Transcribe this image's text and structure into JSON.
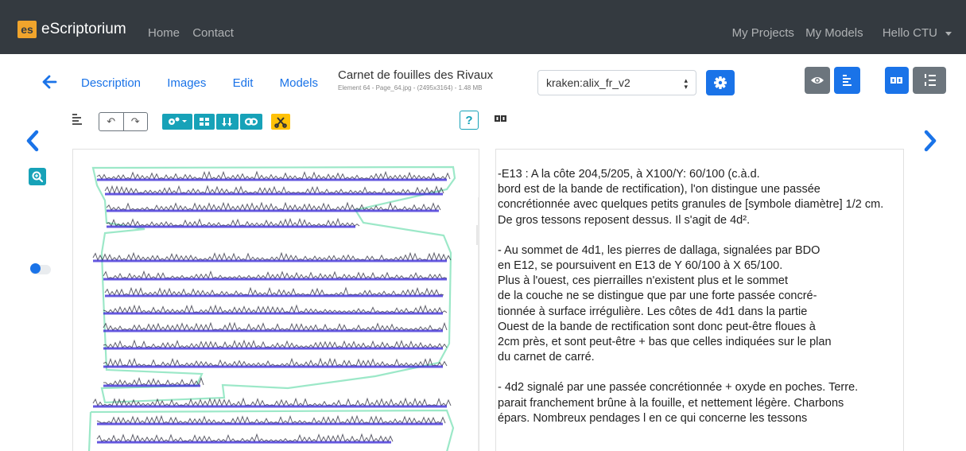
{
  "navbar": {
    "logo_text": "es",
    "brand": "eScriptorium",
    "left_links": [
      "Home",
      "Contact"
    ],
    "right_links": [
      "My Projects",
      "My Models",
      "Hello CTU"
    ]
  },
  "tabs": [
    "Description",
    "Images",
    "Edit",
    "Models"
  ],
  "document": {
    "title": "Carnet de fouilles des Rivaux",
    "subtitle": "Element 64 - Page_64.jpg - (2495x3164) - 1.48 MB"
  },
  "model_select": {
    "value": "kraken:alix_fr_v2"
  },
  "help_label": "?",
  "undo_redo": [
    "↶",
    "↷"
  ],
  "colors": {
    "primary": "#1a73e8",
    "info": "#17a2b8",
    "warning": "#ffc107",
    "secondary": "#6c757d",
    "navbar": "#343a40",
    "baseline": "#3f2fd8",
    "mask": "#9ce8c8"
  },
  "transcription": [
    [
      "-E13 : A la côte 204,5/205, à X100/Y: 60/100 (c.à.d.",
      "bord est de la bande de rectification), l'on distingue une passée",
      "concrétionnée avec quelques petits granules de [symbole diamètre] 1/2 cm.",
      "De gros  tessons reposent dessus. Il s'agit de 4d²."
    ],
    [
      "- Au sommet de 4d1, les pierres de dallaga, signalées par BDO",
      "en E12, se poursuivent en E13 de Y 60/100 à X 65/100.",
      "Plus à l'ouest, ces pierrailles n'existent plus et le sommet",
      "de la couche ne se distingue que par une forte passée concré-",
      "tionnée à surface irrégulière. Les côtes de 4d1 dans la partie",
      "Ouest de la bande de rectification sont donc peut-être floues à",
      "2cm près, et sont peut-être + bas que celles indiquées sur le plan",
      "du carnet de carré."
    ],
    [
      "- 4d2 signalé par une passée concrétionnée + oxyde en poches.  Terre.",
      "parait franchement brûne à la fouille, et nettement légère. Charbons",
      "épars. Nombreux pendages l en ce qui concerne les tessons"
    ]
  ]
}
